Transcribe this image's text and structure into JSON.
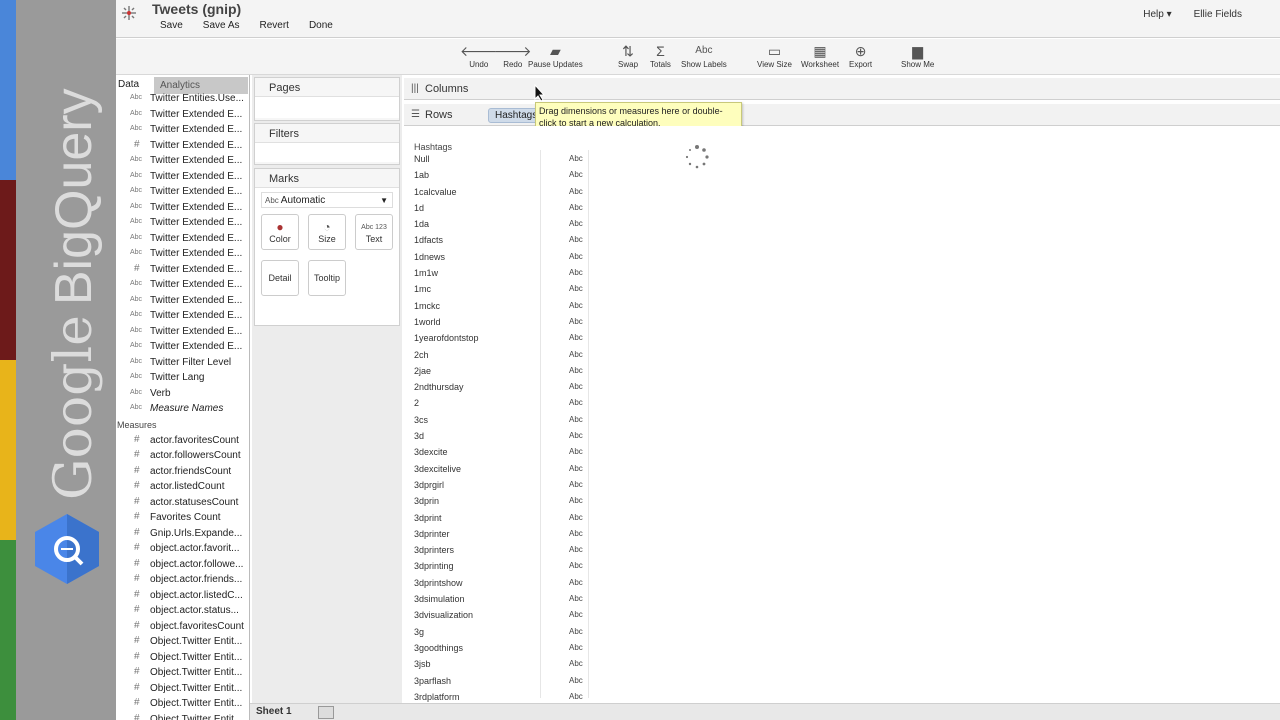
{
  "brand": {
    "word1": "Google",
    "word2": "BigQuery"
  },
  "header": {
    "title": "Tweets (gnip)",
    "menu": [
      "Save",
      "Save As",
      "Revert",
      "Done"
    ],
    "help": "Help ▾",
    "user": "Ellie Fields"
  },
  "toolbar": {
    "undo": "Undo",
    "redo": "Redo",
    "pause": "Pause Updates",
    "swap": "Swap",
    "totals": "Totals",
    "show_labels": "Show Labels",
    "view_size": "View Size",
    "worksheet": "Worksheet",
    "export": "Export",
    "show_me": "Show Me"
  },
  "data_pane": {
    "tab_data": "Data",
    "tab_analytics": "Analytics",
    "dimensions": [
      {
        "type": "Abc",
        "name": "Twitter Entities.Use..."
      },
      {
        "type": "Abc",
        "name": "Twitter Extended E..."
      },
      {
        "type": "Abc",
        "name": "Twitter Extended E..."
      },
      {
        "type": "#",
        "name": "Twitter Extended E..."
      },
      {
        "type": "Abc",
        "name": "Twitter Extended E..."
      },
      {
        "type": "Abc",
        "name": "Twitter Extended E..."
      },
      {
        "type": "Abc",
        "name": "Twitter Extended E..."
      },
      {
        "type": "Abc",
        "name": "Twitter Extended E..."
      },
      {
        "type": "Abc",
        "name": "Twitter Extended E..."
      },
      {
        "type": "Abc",
        "name": "Twitter Extended E..."
      },
      {
        "type": "Abc",
        "name": "Twitter Extended E..."
      },
      {
        "type": "#",
        "name": "Twitter Extended E..."
      },
      {
        "type": "Abc",
        "name": "Twitter Extended E..."
      },
      {
        "type": "Abc",
        "name": "Twitter Extended E..."
      },
      {
        "type": "Abc",
        "name": "Twitter Extended E..."
      },
      {
        "type": "Abc",
        "name": "Twitter Extended E..."
      },
      {
        "type": "Abc",
        "name": "Twitter Extended E..."
      },
      {
        "type": "Abc",
        "name": "Twitter Filter Level"
      },
      {
        "type": "Abc",
        "name": "Twitter Lang"
      },
      {
        "type": "Abc",
        "name": "Verb"
      },
      {
        "type": "Abc",
        "name": "Measure Names",
        "italic": true
      }
    ],
    "measures_label": "Measures",
    "measures": [
      {
        "type": "#",
        "name": "actor.favoritesCount"
      },
      {
        "type": "#",
        "name": "actor.followersCount"
      },
      {
        "type": "#",
        "name": "actor.friendsCount"
      },
      {
        "type": "#",
        "name": "actor.listedCount"
      },
      {
        "type": "#",
        "name": "actor.statusesCount"
      },
      {
        "type": "#",
        "name": "Favorites Count"
      },
      {
        "type": "#",
        "name": "Gnip.Urls.Expande..."
      },
      {
        "type": "#",
        "name": "object.actor.favorit..."
      },
      {
        "type": "#",
        "name": "object.actor.followe..."
      },
      {
        "type": "#",
        "name": "object.actor.friends..."
      },
      {
        "type": "#",
        "name": "object.actor.listedC..."
      },
      {
        "type": "#",
        "name": "object.actor.status..."
      },
      {
        "type": "#",
        "name": "object.favoritesCount"
      },
      {
        "type": "#",
        "name": "Object.Twitter Entit..."
      },
      {
        "type": "#",
        "name": "Object.Twitter Entit..."
      },
      {
        "type": "#",
        "name": "Object.Twitter Entit..."
      },
      {
        "type": "#",
        "name": "Object.Twitter Entit..."
      },
      {
        "type": "#",
        "name": "Object.Twitter Entit..."
      },
      {
        "type": "#",
        "name": "Object.Twitter Entit..."
      }
    ]
  },
  "cards": {
    "pages": "Pages",
    "filters": "Filters",
    "marks": "Marks",
    "mark_type_abc": "Abc",
    "mark_type": "Automatic",
    "color": "Color",
    "size": "Size",
    "text": "Text",
    "text_icon": "Abc 123",
    "detail": "Detail",
    "tooltip": "Tooltip"
  },
  "shelves": {
    "columns": "Columns",
    "rows": "Rows",
    "rows_pill": "Hashtags"
  },
  "tooltip": "Drag dimensions or measures here or double-click to start a new calculation.",
  "view": {
    "column_header": "Hashtags",
    "abc": "Abc",
    "rows": [
      "Null",
      "1ab",
      "1calcvalue",
      "1d",
      "1da",
      "1dfacts",
      "1dnews",
      "1m1w",
      "1mc",
      "1mckc",
      "1world",
      "1yearofdontstop",
      "2ch",
      "2jae",
      "2ndthursday",
      "2",
      "3cs",
      "3d",
      "3dexcite",
      "3dexcitelive",
      "3dprgirl",
      "3dprin",
      "3dprint",
      "3dprinter",
      "3dprinters",
      "3dprinting",
      "3dprintshow",
      "3dsimulation",
      "3dvisualization",
      "3g",
      "3goodthings",
      "3jsb",
      "3parflash",
      "3rdplatform"
    ]
  },
  "bottom": {
    "sheet": "Sheet 1"
  }
}
